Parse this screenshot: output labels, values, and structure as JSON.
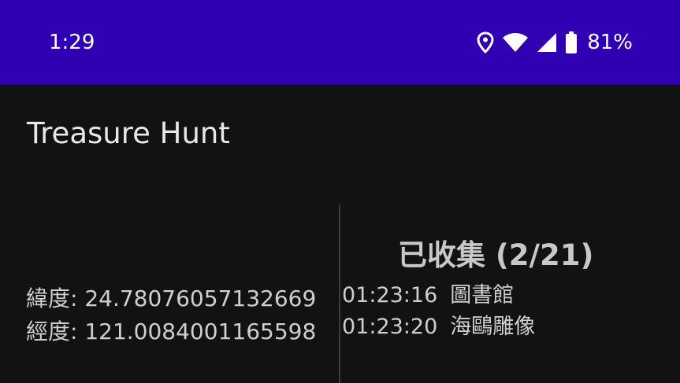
{
  "status_bar": {
    "time": "1:29",
    "battery_percent": "81%",
    "icons": [
      "location-icon",
      "wifi-icon",
      "cell-signal-icon",
      "battery-icon"
    ],
    "background_color": "#3000b3"
  },
  "app": {
    "title": "Treasure Hunt"
  },
  "location": {
    "latitude_label": "緯度: 24.78076057132669",
    "longitude_label": "經度: 121.0084001165598"
  },
  "collected": {
    "heading": "已收集 (2/21)",
    "items": [
      {
        "time": "01:23:16",
        "name": "圖書館"
      },
      {
        "time": "01:23:20",
        "name": "海鷗雕像"
      }
    ]
  }
}
